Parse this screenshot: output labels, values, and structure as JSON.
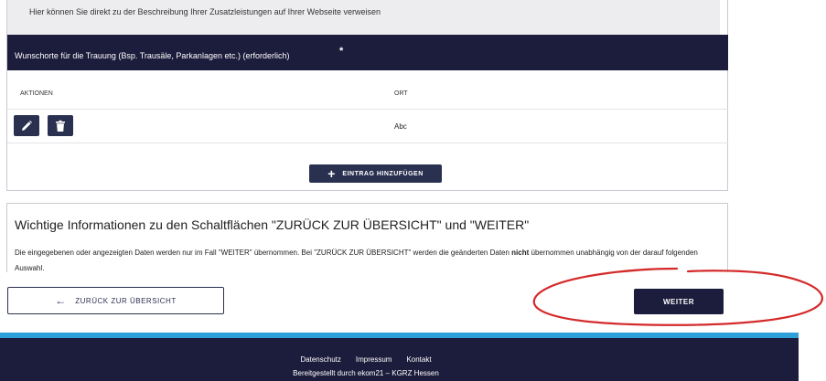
{
  "top_card": {
    "hint": "Hier können Sie direkt zu der Beschreibung Ihrer Zusatzleistungen auf Ihrer Webseite verweisen"
  },
  "section": {
    "title": "Wunschorte für die Trauung (Bsp. Trausäle, Parkanlagen etc.) (erforderlich)",
    "required_marker": "*"
  },
  "table": {
    "columns": [
      "AKTIONEN",
      "ORT"
    ],
    "rows": [
      {
        "ort": "Abc"
      }
    ],
    "add_button_label": "EINTRAG HINZUFÜGEN"
  },
  "icons": {
    "edit": "pencil-icon",
    "delete": "trash-icon",
    "add": "plus-icon",
    "back": "arrow-left-icon"
  },
  "info": {
    "title": "Wichtige Informationen zu den Schaltflächen \"ZURÜCK ZUR ÜBERSICHT\" und \"WEITER\"",
    "body_before": "Die eingegebenen oder angezeigten Daten werden nur im Fall \"WEITER\" übernommen. Bei \"ZURÜCK ZUR ÜBERSICHT\" werden die geänderten Daten ",
    "body_bold": "nicht",
    "body_after": " übernommen unabhängig von der darauf folgenden Auswahl."
  },
  "nav": {
    "back_label": "ZURÜCK ZUR ÜBERSICHT",
    "next_label": "WEITER"
  },
  "footer": {
    "links": [
      "Datenschutz",
      "Impressum",
      "Kontakt"
    ],
    "credit": "Bereitgestellt durch ekom21 – KGRZ Hessen"
  },
  "colors": {
    "navy": "#1c1c3c",
    "button": "#2a3150",
    "accent_stripe": "#2d9fd9",
    "annotation_red": "#d42a2a"
  }
}
